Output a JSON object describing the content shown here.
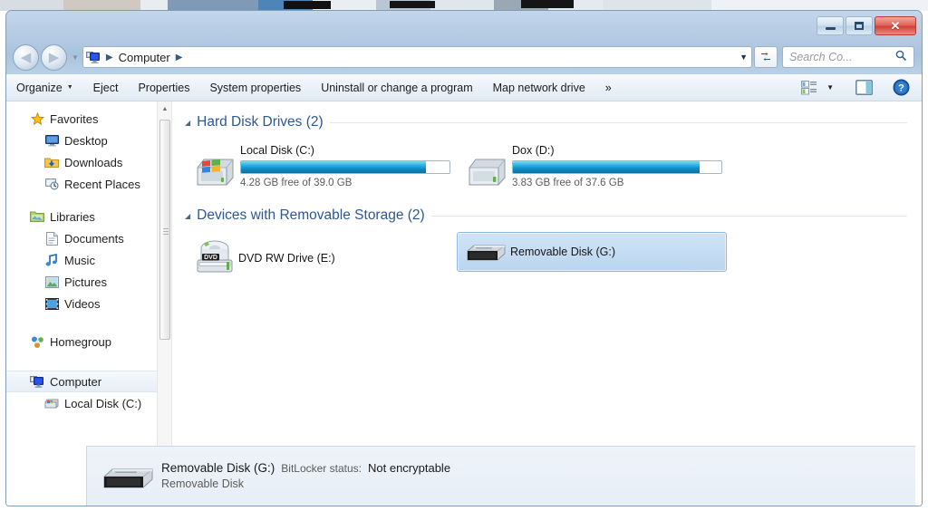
{
  "window": {
    "controls": {
      "minimize": "–",
      "maximize": "□",
      "close": "✕"
    }
  },
  "address": {
    "computer_icon": "computer-icon",
    "crumb": "Computer",
    "sep1": "▶",
    "sep2": "▶",
    "dropdown": "▼",
    "refresh": "↻"
  },
  "search": {
    "placeholder": "Search Co...",
    "icon": "🔍"
  },
  "toolbar": {
    "items": [
      {
        "label": "Organize",
        "has_caret": true
      },
      {
        "label": "Eject",
        "has_caret": false
      },
      {
        "label": "Properties",
        "has_caret": false
      },
      {
        "label": "System properties",
        "has_caret": false
      },
      {
        "label": "Uninstall or change a program",
        "has_caret": false
      },
      {
        "label": "Map network drive",
        "has_caret": false
      }
    ],
    "overflow": "»",
    "view_caret": "▼",
    "help": "?"
  },
  "sidebar": {
    "groups": [
      {
        "header": {
          "label": "Favorites",
          "icon": "star-icon"
        },
        "items": [
          {
            "label": "Desktop",
            "icon": "desktop-icon"
          },
          {
            "label": "Downloads",
            "icon": "downloads-folder-icon"
          },
          {
            "label": "Recent Places",
            "icon": "recent-places-icon"
          }
        ]
      },
      {
        "header": {
          "label": "Libraries",
          "icon": "libraries-icon"
        },
        "items": [
          {
            "label": "Documents",
            "icon": "documents-icon"
          },
          {
            "label": "Music",
            "icon": "music-icon"
          },
          {
            "label": "Pictures",
            "icon": "pictures-icon"
          },
          {
            "label": "Videos",
            "icon": "videos-icon"
          }
        ]
      },
      {
        "header": {
          "label": "Homegroup",
          "icon": "homegroup-icon"
        },
        "items": []
      },
      {
        "header": {
          "label": "Computer",
          "icon": "computer-icon",
          "selected": true
        },
        "items": [
          {
            "label": "Local Disk (C:)",
            "icon": "hard-disk-icon"
          }
        ]
      }
    ],
    "scrollbar": {
      "up": "▲",
      "down": "▼"
    }
  },
  "content": {
    "groups": [
      {
        "title": "Hard Disk Drives (2)",
        "triangle": "◢",
        "type": "drives",
        "items": [
          {
            "name": "Local Disk (C:)",
            "free_text": "4.28 GB free of 39.0 GB",
            "used_percent": 89,
            "icon": "windows-hard-disk-icon",
            "selected": false
          },
          {
            "name": "Dox (D:)",
            "free_text": "3.83 GB free of 37.6 GB",
            "used_percent": 90,
            "icon": "hard-disk-icon",
            "selected": false
          }
        ]
      },
      {
        "title": "Devices with Removable Storage (2)",
        "triangle": "◢",
        "type": "devices",
        "items": [
          {
            "name": "DVD RW Drive (E:)",
            "icon": "dvd-drive-icon",
            "selected": false
          },
          {
            "name": "Removable Disk (G:)",
            "icon": "removable-disk-icon",
            "selected": true
          }
        ]
      }
    ]
  },
  "details": {
    "icon": "removable-disk-icon",
    "title": "Removable Disk (G:)",
    "bitlocker_label": "BitLocker status:",
    "bitlocker_value": "Not encryptable",
    "subtitle": "Removable Disk"
  },
  "colors": {
    "group_header": "#2b5797",
    "selection": "#bdd8f0",
    "bar_fill": "#0e8fc4",
    "close_button": "#cf4237"
  }
}
